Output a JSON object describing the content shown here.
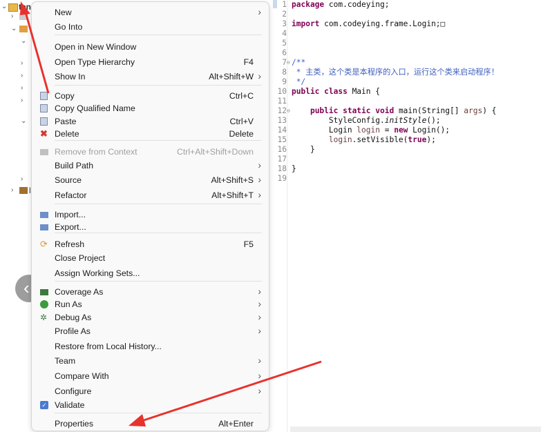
{
  "explorer": {
    "project_label": "ten",
    "second_label": "l"
  },
  "editor": {
    "lines": [
      {
        "n": "1",
        "fold": "",
        "html": "<span class=\"kw\">package</span> com.codeying;"
      },
      {
        "n": "2",
        "fold": "",
        "html": ""
      },
      {
        "n": "3",
        "fold": "",
        "html": "<span class=\"kw\">import</span> com.codeying.frame.Login;□"
      },
      {
        "n": "4",
        "fold": "",
        "html": ""
      },
      {
        "n": "5",
        "fold": "",
        "html": ""
      },
      {
        "n": "6",
        "fold": "",
        "html": ""
      },
      {
        "n": "7",
        "fold": "⊖",
        "html": "<span class=\"cm\">/**</span>"
      },
      {
        "n": "8",
        "fold": "",
        "html": "<span class=\"cm\"> * 主类，这个类是本程序的入口，运行这个类来启动程序！</span>"
      },
      {
        "n": "9",
        "fold": "",
        "html": "<span class=\"cm\"> */</span>"
      },
      {
        "n": "10",
        "fold": "",
        "html": "<span class=\"kw\">public class</span> Main {"
      },
      {
        "n": "11",
        "fold": "",
        "html": ""
      },
      {
        "n": "12",
        "fold": "⊖",
        "html": "    <span class=\"kw\">public static void</span> main(String[] <span class=\"var\">args</span>) {"
      },
      {
        "n": "13",
        "fold": "",
        "html": "        StyleConfig.<span class=\"it\">initStyle</span>();"
      },
      {
        "n": "14",
        "fold": "",
        "html": "        Login <span class=\"var\">login</span> = <span class=\"kw\">new</span> Login();"
      },
      {
        "n": "15",
        "fold": "",
        "html": "        <span class=\"var\">login</span>.setVisible(<span class=\"kw\">true</span>);"
      },
      {
        "n": "16",
        "fold": "",
        "html": "    }"
      },
      {
        "n": "17",
        "fold": "",
        "html": ""
      },
      {
        "n": "18",
        "fold": "",
        "html": "}"
      },
      {
        "n": "19",
        "fold": "",
        "html": ""
      }
    ]
  },
  "menu": {
    "items": [
      {
        "name": "new",
        "label": "New",
        "shortcut": "",
        "submenu": true,
        "icon": "",
        "disabled": false
      },
      {
        "name": "go-into",
        "label": "Go Into",
        "shortcut": "",
        "submenu": false,
        "icon": "",
        "disabled": false
      },
      {
        "sep": true
      },
      {
        "name": "open-in-new-window",
        "label": "Open in New Window",
        "shortcut": "",
        "submenu": false,
        "icon": "",
        "disabled": false
      },
      {
        "name": "open-type-hierarchy",
        "label": "Open Type Hierarchy",
        "shortcut": "F4",
        "submenu": false,
        "icon": "",
        "disabled": false
      },
      {
        "name": "show-in",
        "label": "Show In",
        "shortcut": "Alt+Shift+W",
        "submenu": true,
        "icon": "",
        "disabled": false
      },
      {
        "sep": true
      },
      {
        "name": "copy",
        "label": "Copy",
        "shortcut": "Ctrl+C",
        "submenu": false,
        "icon": "copy-icon",
        "disabled": false
      },
      {
        "name": "copy-qualified-name",
        "label": "Copy Qualified Name",
        "shortcut": "",
        "submenu": false,
        "icon": "copy-icon",
        "disabled": false
      },
      {
        "name": "paste",
        "label": "Paste",
        "shortcut": "Ctrl+V",
        "submenu": false,
        "icon": "paste-icon",
        "disabled": false
      },
      {
        "name": "delete",
        "label": "Delete",
        "shortcut": "Delete",
        "submenu": false,
        "icon": "delete-icon",
        "disabled": false
      },
      {
        "sep": true
      },
      {
        "name": "remove-from-context",
        "label": "Remove from Context",
        "shortcut": "Ctrl+Alt+Shift+Down",
        "submenu": false,
        "icon": "remove-context-icon",
        "disabled": true
      },
      {
        "name": "build-path",
        "label": "Build Path",
        "shortcut": "",
        "submenu": true,
        "icon": "",
        "disabled": false
      },
      {
        "name": "source",
        "label": "Source",
        "shortcut": "Alt+Shift+S",
        "submenu": true,
        "icon": "",
        "disabled": false
      },
      {
        "name": "refactor",
        "label": "Refactor",
        "shortcut": "Alt+Shift+T",
        "submenu": true,
        "icon": "",
        "disabled": false
      },
      {
        "sep": true
      },
      {
        "name": "import",
        "label": "Import...",
        "shortcut": "",
        "submenu": false,
        "icon": "import-icon",
        "disabled": false
      },
      {
        "name": "export",
        "label": "Export...",
        "shortcut": "",
        "submenu": false,
        "icon": "export-icon",
        "disabled": false
      },
      {
        "sep": true
      },
      {
        "name": "refresh",
        "label": "Refresh",
        "shortcut": "F5",
        "submenu": false,
        "icon": "refresh-icon",
        "disabled": false
      },
      {
        "name": "close-project",
        "label": "Close Project",
        "shortcut": "",
        "submenu": false,
        "icon": "",
        "disabled": false
      },
      {
        "name": "assign-working-sets",
        "label": "Assign Working Sets...",
        "shortcut": "",
        "submenu": false,
        "icon": "",
        "disabled": false
      },
      {
        "sep": true
      },
      {
        "name": "coverage-as",
        "label": "Coverage As",
        "shortcut": "",
        "submenu": true,
        "icon": "coverage-icon",
        "disabled": false
      },
      {
        "name": "run-as",
        "label": "Run As",
        "shortcut": "",
        "submenu": true,
        "icon": "run-icon",
        "disabled": false
      },
      {
        "name": "debug-as",
        "label": "Debug As",
        "shortcut": "",
        "submenu": true,
        "icon": "debug-icon",
        "disabled": false
      },
      {
        "name": "profile-as",
        "label": "Profile As",
        "shortcut": "",
        "submenu": true,
        "icon": "",
        "disabled": false
      },
      {
        "name": "restore-from-local-history",
        "label": "Restore from Local History...",
        "shortcut": "",
        "submenu": false,
        "icon": "",
        "disabled": false
      },
      {
        "name": "team",
        "label": "Team",
        "shortcut": "",
        "submenu": true,
        "icon": "",
        "disabled": false
      },
      {
        "name": "compare-with",
        "label": "Compare With",
        "shortcut": "",
        "submenu": true,
        "icon": "",
        "disabled": false
      },
      {
        "name": "configure",
        "label": "Configure",
        "shortcut": "",
        "submenu": true,
        "icon": "",
        "disabled": false
      },
      {
        "name": "validate",
        "label": "Validate",
        "shortcut": "",
        "submenu": false,
        "icon": "validate-icon",
        "disabled": false
      },
      {
        "sep": true
      },
      {
        "name": "properties",
        "label": "Properties",
        "shortcut": "Alt+Enter",
        "submenu": false,
        "icon": "",
        "disabled": false
      }
    ]
  },
  "annotation_color": "#e8322c"
}
